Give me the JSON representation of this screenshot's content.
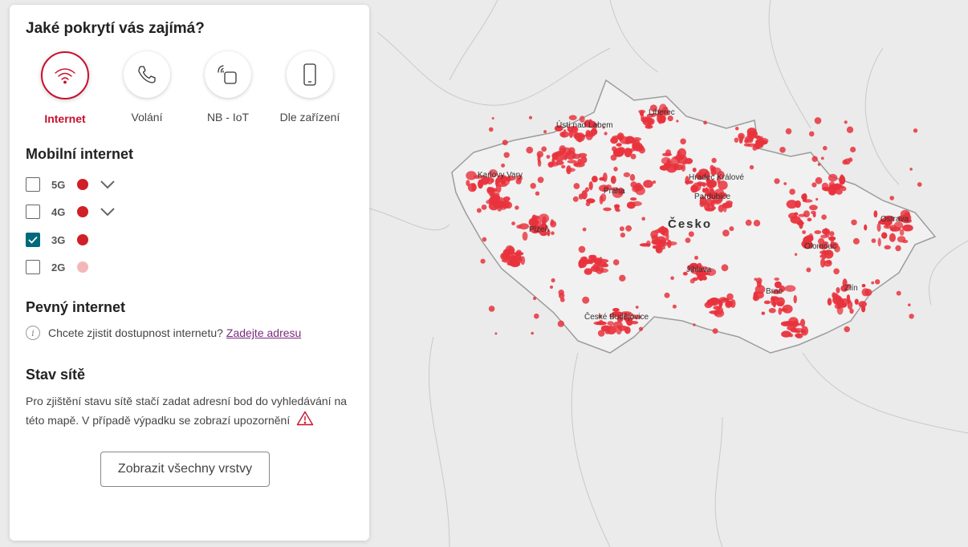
{
  "panel": {
    "title": "Jaké pokrytí vás zajímá?",
    "coverage_types": [
      {
        "label": "Internet",
        "icon": "wifi-icon",
        "active": true
      },
      {
        "label": "Volání",
        "icon": "phone-icon",
        "active": false
      },
      {
        "label": "NB - IoT",
        "icon": "iot-icon",
        "active": false
      },
      {
        "label": "Dle zařízení",
        "icon": "device-icon",
        "active": false
      }
    ],
    "mobile_internet": {
      "heading": "Mobilní internet",
      "layers": [
        {
          "label": "5G",
          "checked": false,
          "color": "#d01f26",
          "expandable": true
        },
        {
          "label": "4G",
          "checked": false,
          "color": "#d01f26",
          "expandable": true
        },
        {
          "label": "3G",
          "checked": true,
          "color": "#d01f26",
          "expandable": false
        },
        {
          "label": "2G",
          "checked": false,
          "color": "#f4b7b9",
          "expandable": false
        }
      ]
    },
    "fixed_internet": {
      "heading": "Pevný internet",
      "question": "Chcete zjistit dostupnost internetu?",
      "link": "Zadejte adresu"
    },
    "network_status": {
      "heading": "Stav sítě",
      "text": "Pro zjištění stavu sítě stačí zadat adresní bod do vyhledávání na této mapě. V případě výpadku se zobrazí upozornění"
    },
    "show_all_button": "Zobrazit všechny vrstvy"
  },
  "map": {
    "country_label": "Česko",
    "cities": [
      "Ústí nad Labem",
      "Liberec",
      "Karlovy Vary",
      "Hradec Králové",
      "Praha",
      "Pardubice",
      "Ostrava",
      "Plzeň",
      "Olomouc",
      "Jihlava",
      "Zlín",
      "Brno",
      "České Budějovice"
    ],
    "coverage_color": "#e8323c"
  }
}
